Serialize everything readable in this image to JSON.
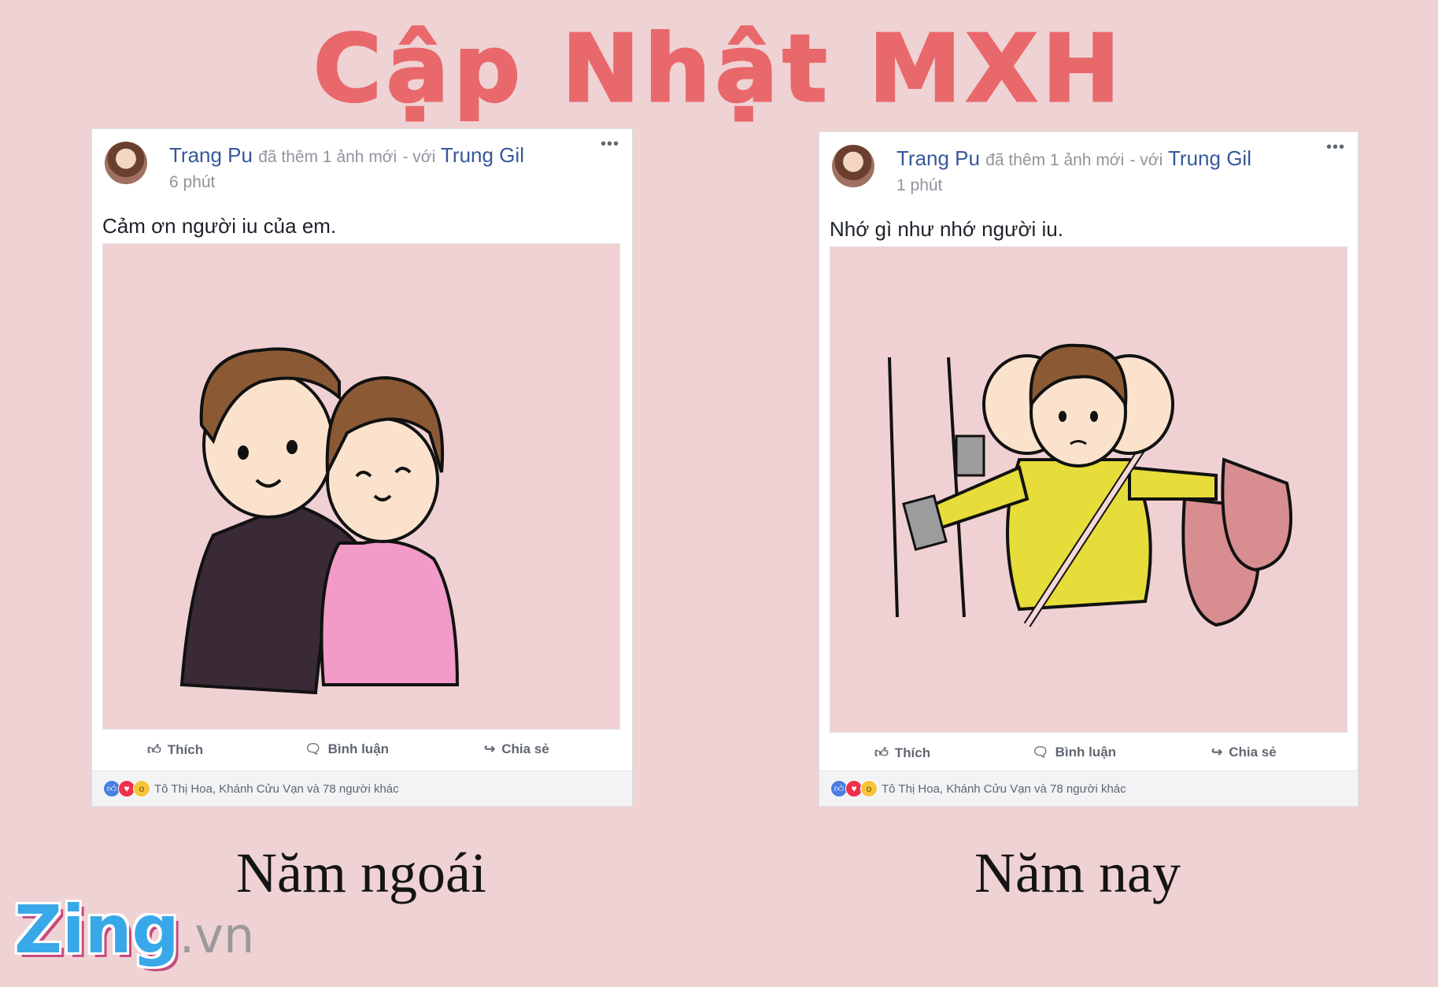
{
  "title": "Cập Nhật MXH",
  "posts": [
    {
      "author": "Trang Pu",
      "action": "đã thêm 1 ảnh mới",
      "with_text": "- với",
      "tagged": "Trung Gil",
      "time": "6 phút",
      "caption": "Cảm ơn người iu của em.",
      "actions": [
        "Thích",
        "Bình luận",
        "Chia sẻ"
      ],
      "reactions_text": "Tô Thị Hoa, Khánh Cửu Vạn và 78 người khác",
      "label": "Năm ngoái"
    },
    {
      "author": "Trang Pu",
      "action": "đã thêm 1 ảnh mới",
      "with_text": "- với",
      "tagged": "Trung Gil",
      "time": "1 phút",
      "caption": "Nhớ gì như nhớ người iu.",
      "actions": [
        "Thích",
        "Bình luận",
        "Chia sẻ"
      ],
      "reactions_text": "Tô Thị Hoa, Khánh Cửu Vạn và 78 người khác",
      "label": "Năm nay"
    }
  ],
  "logo": {
    "main": "Zing",
    "suffix": ".vn"
  },
  "icons": {
    "more": "more-dots-icon",
    "like": "thumbs-up-icon",
    "comment": "comment-icon",
    "share": "share-icon"
  },
  "colors": {
    "background": "#efd2d3",
    "title": "#e8686c",
    "link": "#365899"
  }
}
